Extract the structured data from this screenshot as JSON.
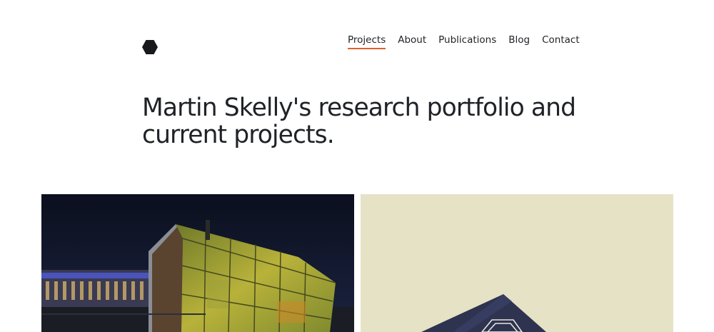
{
  "header": {
    "logo_icon": "hexagon-logo-icon",
    "nav": [
      {
        "label": "Projects",
        "active": true
      },
      {
        "label": "About",
        "active": false
      },
      {
        "label": "Publications",
        "active": false
      },
      {
        "label": "Blog",
        "active": false
      },
      {
        "label": "Contact",
        "active": false
      }
    ]
  },
  "hero": {
    "headline": "Martin Skelly's research portfolio and current projects."
  },
  "projects": [
    {
      "image": "night-greenhouse-photo"
    },
    {
      "image": "dark-box-on-cream-photo"
    }
  ],
  "colors": {
    "accent": "#e0612b",
    "text": "#1f2226",
    "card_right_bg": "#e6e2c6"
  }
}
